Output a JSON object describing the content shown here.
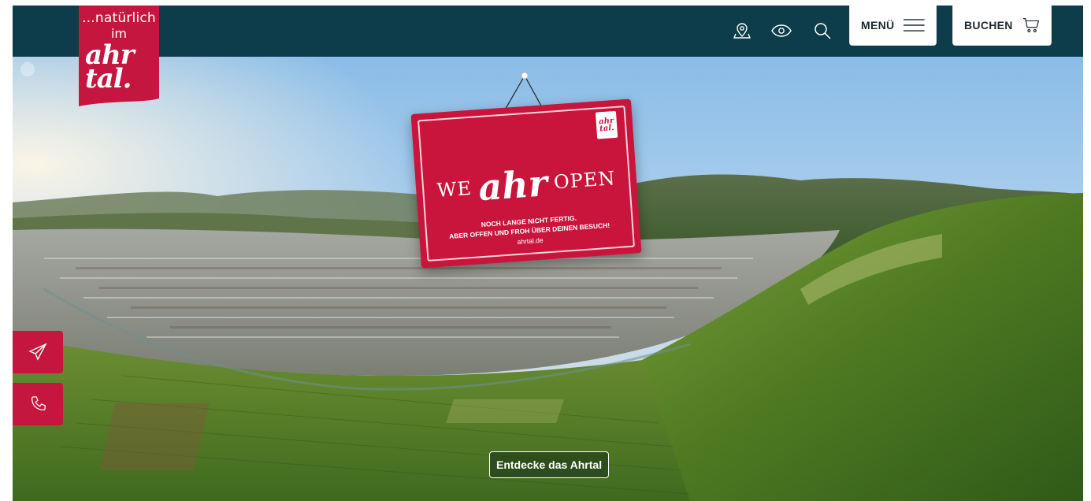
{
  "header": {
    "logo": {
      "line1": "...natürlich",
      "line2": "im",
      "word": "ahr tal."
    },
    "icons": [
      "map-pin-icon",
      "eye-icon",
      "search-icon"
    ],
    "menu_label": "MENÜ",
    "book_label": "BUCHEN"
  },
  "hero": {
    "sign": {
      "logo_text": "ahr tal.",
      "we": "WE",
      "ahr": "ahr",
      "open": "OPEN",
      "subline1": "NOCH LANGE NICHT FERTIG.",
      "subline2": "ABER OFFEN UND FROH ÜBER DEINEN BESUCH!",
      "url": "ahrtal.de"
    },
    "cta_label": "Entdecke das Ahrtal"
  },
  "side_actions": [
    {
      "icon": "paper-plane-icon"
    },
    {
      "icon": "phone-icon"
    }
  ],
  "colors": {
    "topbar": "#0d3c4a",
    "brand_red": "#c4163f",
    "white": "#ffffff"
  }
}
